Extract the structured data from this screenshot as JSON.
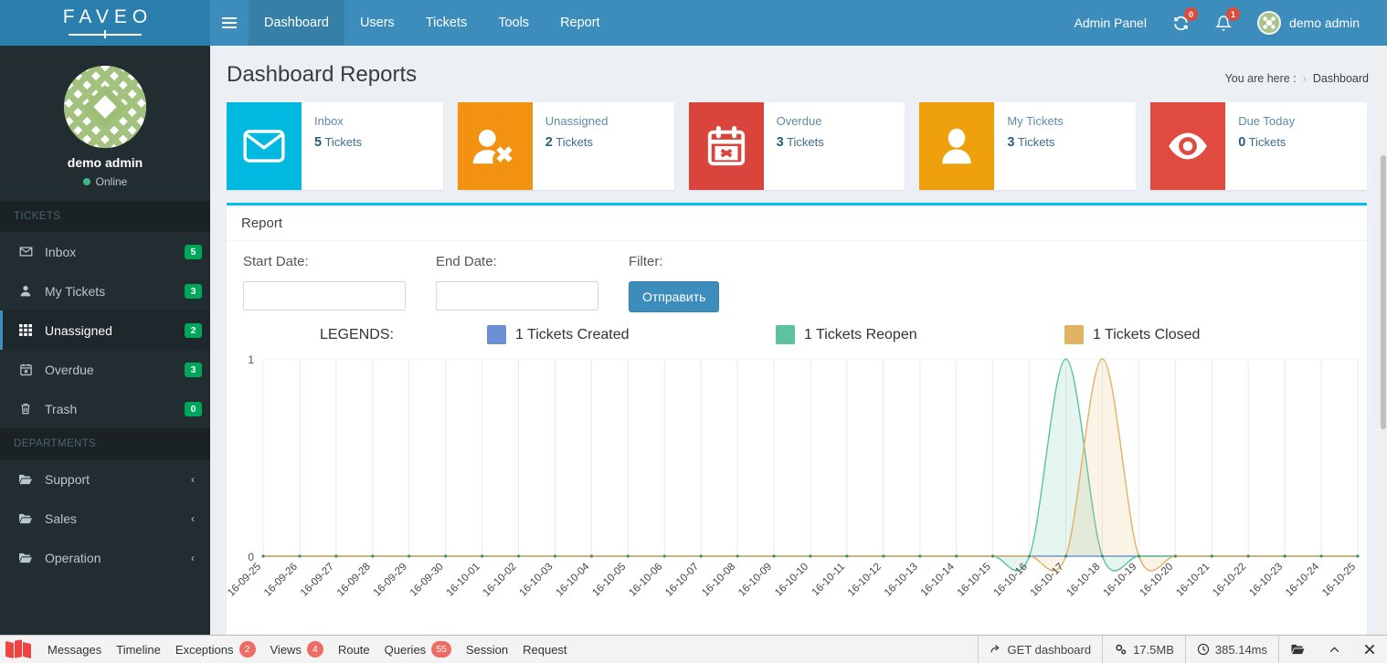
{
  "brand": {
    "name": "FAVEO"
  },
  "topnav": {
    "menu_icon": "hamburger-icon",
    "items": [
      {
        "label": "Dashboard",
        "active": true
      },
      {
        "label": "Users",
        "active": false
      },
      {
        "label": "Tickets",
        "active": false
      },
      {
        "label": "Tools",
        "active": false
      },
      {
        "label": "Report",
        "active": false
      }
    ],
    "admin_panel_label": "Admin Panel",
    "sync_badge": "0",
    "bell_badge": "1",
    "user_label": "demo admin"
  },
  "sidebar": {
    "user": {
      "name": "demo admin",
      "status": "Online"
    },
    "section_tickets": "TICKETS",
    "section_departments": "DEPARTMENTS",
    "ticket_items": [
      {
        "label": "Inbox",
        "badge": "5",
        "icon": "envelope-icon",
        "active": false
      },
      {
        "label": "My Tickets",
        "badge": "3",
        "icon": "user-icon",
        "active": false
      },
      {
        "label": "Unassigned",
        "badge": "2",
        "icon": "grid-icon",
        "active": true
      },
      {
        "label": "Overdue",
        "badge": "3",
        "icon": "calendar-x-icon",
        "active": false
      },
      {
        "label": "Trash",
        "badge": "0",
        "icon": "trash-icon",
        "active": false
      }
    ],
    "department_items": [
      {
        "label": "Support",
        "icon": "folder-open-icon",
        "chevron": "‹"
      },
      {
        "label": "Sales",
        "icon": "folder-open-icon",
        "chevron": "‹"
      },
      {
        "label": "Operation",
        "icon": "folder-open-icon",
        "chevron": "‹"
      }
    ]
  },
  "page": {
    "title": "Dashboard Reports",
    "breadcrumb_prefix": "You are here :",
    "breadcrumb_sep": "›",
    "breadcrumb_current": "Dashboard"
  },
  "cards": [
    {
      "label": "Inbox",
      "count": "5",
      "unit": "Tickets",
      "color": "#00b8e0",
      "icon": "envelope-icon"
    },
    {
      "label": "Unassigned",
      "count": "2",
      "unit": "Tickets",
      "color": "#f39211",
      "icon": "user-times-icon"
    },
    {
      "label": "Overdue",
      "count": "3",
      "unit": "Tickets",
      "color": "#d9443c",
      "icon": "calendar-x-icon"
    },
    {
      "label": "My Tickets",
      "count": "3",
      "unit": "Tickets",
      "color": "#eda00b",
      "icon": "user-icon"
    },
    {
      "label": "Due Today",
      "count": "0",
      "unit": "Tickets",
      "color": "#e04a3f",
      "icon": "eye-icon"
    }
  ],
  "report": {
    "panel_title": "Report",
    "start_date_label": "Start Date:",
    "end_date_label": "End Date:",
    "filter_label": "Filter:",
    "start_date_value": "",
    "end_date_value": "",
    "start_date_placeholder": "",
    "end_date_placeholder": "",
    "submit_label": "Отправить",
    "legends_label": "LEGENDS:"
  },
  "chart_data": {
    "type": "area",
    "title": "",
    "xlabel": "",
    "ylabel": "",
    "ylim": [
      0,
      1
    ],
    "yticks": [
      "0",
      "1"
    ],
    "grid": true,
    "legend_position": "top",
    "categories": [
      "16-09-25",
      "16-09-26",
      "16-09-27",
      "16-09-28",
      "16-09-29",
      "16-09-30",
      "16-10-01",
      "16-10-02",
      "16-10-03",
      "16-10-04",
      "16-10-05",
      "16-10-06",
      "16-10-07",
      "16-10-08",
      "16-10-09",
      "16-10-10",
      "16-10-11",
      "16-10-12",
      "16-10-13",
      "16-10-14",
      "16-10-15",
      "16-10-16",
      "16-10-17",
      "16-10-18",
      "16-10-19",
      "16-10-20",
      "16-10-21",
      "16-10-22",
      "16-10-23",
      "16-10-24",
      "16-10-25"
    ],
    "series": [
      {
        "name": "1 Tickets Created",
        "color": "#6b8fd4",
        "values": [
          0,
          0,
          0,
          0,
          0,
          0,
          0,
          0,
          0,
          0,
          0,
          0,
          0,
          0,
          0,
          0,
          0,
          0,
          0,
          0,
          0,
          0,
          0,
          0,
          0,
          0,
          0,
          0,
          0,
          0,
          0
        ]
      },
      {
        "name": "1 Tickets Reopen",
        "color": "#5cc2a0",
        "values": [
          0,
          0,
          0,
          0,
          0,
          0,
          0,
          0,
          0,
          0,
          0,
          0,
          0,
          0,
          0,
          0,
          0,
          0,
          0,
          0,
          0,
          0,
          1,
          0,
          0,
          0,
          0,
          0,
          0,
          0,
          0
        ]
      },
      {
        "name": "1 Tickets Closed",
        "color": "#e0b264",
        "values": [
          0,
          0,
          0,
          0,
          0,
          0,
          0,
          0,
          0,
          0,
          0,
          0,
          0,
          0,
          0,
          0,
          0,
          0,
          0,
          0,
          0,
          0,
          0,
          1,
          0,
          0,
          0,
          0,
          0,
          0,
          0
        ]
      }
    ]
  },
  "debugbar": {
    "items": [
      {
        "label": "Messages",
        "badge": null
      },
      {
        "label": "Timeline",
        "badge": null
      },
      {
        "label": "Exceptions",
        "badge": "2"
      },
      {
        "label": "Views",
        "badge": "4"
      },
      {
        "label": "Route",
        "badge": null
      },
      {
        "label": "Queries",
        "badge": "55"
      },
      {
        "label": "Session",
        "badge": null
      },
      {
        "label": "Request",
        "badge": null
      }
    ],
    "request_label": "GET dashboard",
    "memory_label": "17.5MB",
    "time_label": "385.14ms"
  }
}
